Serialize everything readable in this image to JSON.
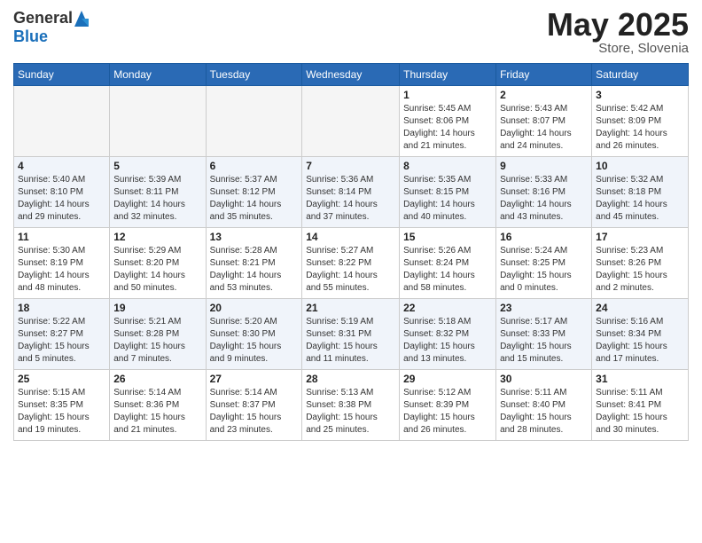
{
  "logo": {
    "general": "General",
    "blue": "Blue"
  },
  "header": {
    "month": "May 2025",
    "location": "Store, Slovenia"
  },
  "weekdays": [
    "Sunday",
    "Monday",
    "Tuesday",
    "Wednesday",
    "Thursday",
    "Friday",
    "Saturday"
  ],
  "weeks": [
    [
      {
        "day": "",
        "info": ""
      },
      {
        "day": "",
        "info": ""
      },
      {
        "day": "",
        "info": ""
      },
      {
        "day": "",
        "info": ""
      },
      {
        "day": "1",
        "info": "Sunrise: 5:45 AM\nSunset: 8:06 PM\nDaylight: 14 hours\nand 21 minutes."
      },
      {
        "day": "2",
        "info": "Sunrise: 5:43 AM\nSunset: 8:07 PM\nDaylight: 14 hours\nand 24 minutes."
      },
      {
        "day": "3",
        "info": "Sunrise: 5:42 AM\nSunset: 8:09 PM\nDaylight: 14 hours\nand 26 minutes."
      }
    ],
    [
      {
        "day": "4",
        "info": "Sunrise: 5:40 AM\nSunset: 8:10 PM\nDaylight: 14 hours\nand 29 minutes."
      },
      {
        "day": "5",
        "info": "Sunrise: 5:39 AM\nSunset: 8:11 PM\nDaylight: 14 hours\nand 32 minutes."
      },
      {
        "day": "6",
        "info": "Sunrise: 5:37 AM\nSunset: 8:12 PM\nDaylight: 14 hours\nand 35 minutes."
      },
      {
        "day": "7",
        "info": "Sunrise: 5:36 AM\nSunset: 8:14 PM\nDaylight: 14 hours\nand 37 minutes."
      },
      {
        "day": "8",
        "info": "Sunrise: 5:35 AM\nSunset: 8:15 PM\nDaylight: 14 hours\nand 40 minutes."
      },
      {
        "day": "9",
        "info": "Sunrise: 5:33 AM\nSunset: 8:16 PM\nDaylight: 14 hours\nand 43 minutes."
      },
      {
        "day": "10",
        "info": "Sunrise: 5:32 AM\nSunset: 8:18 PM\nDaylight: 14 hours\nand 45 minutes."
      }
    ],
    [
      {
        "day": "11",
        "info": "Sunrise: 5:30 AM\nSunset: 8:19 PM\nDaylight: 14 hours\nand 48 minutes."
      },
      {
        "day": "12",
        "info": "Sunrise: 5:29 AM\nSunset: 8:20 PM\nDaylight: 14 hours\nand 50 minutes."
      },
      {
        "day": "13",
        "info": "Sunrise: 5:28 AM\nSunset: 8:21 PM\nDaylight: 14 hours\nand 53 minutes."
      },
      {
        "day": "14",
        "info": "Sunrise: 5:27 AM\nSunset: 8:22 PM\nDaylight: 14 hours\nand 55 minutes."
      },
      {
        "day": "15",
        "info": "Sunrise: 5:26 AM\nSunset: 8:24 PM\nDaylight: 14 hours\nand 58 minutes."
      },
      {
        "day": "16",
        "info": "Sunrise: 5:24 AM\nSunset: 8:25 PM\nDaylight: 15 hours\nand 0 minutes."
      },
      {
        "day": "17",
        "info": "Sunrise: 5:23 AM\nSunset: 8:26 PM\nDaylight: 15 hours\nand 2 minutes."
      }
    ],
    [
      {
        "day": "18",
        "info": "Sunrise: 5:22 AM\nSunset: 8:27 PM\nDaylight: 15 hours\nand 5 minutes."
      },
      {
        "day": "19",
        "info": "Sunrise: 5:21 AM\nSunset: 8:28 PM\nDaylight: 15 hours\nand 7 minutes."
      },
      {
        "day": "20",
        "info": "Sunrise: 5:20 AM\nSunset: 8:30 PM\nDaylight: 15 hours\nand 9 minutes."
      },
      {
        "day": "21",
        "info": "Sunrise: 5:19 AM\nSunset: 8:31 PM\nDaylight: 15 hours\nand 11 minutes."
      },
      {
        "day": "22",
        "info": "Sunrise: 5:18 AM\nSunset: 8:32 PM\nDaylight: 15 hours\nand 13 minutes."
      },
      {
        "day": "23",
        "info": "Sunrise: 5:17 AM\nSunset: 8:33 PM\nDaylight: 15 hours\nand 15 minutes."
      },
      {
        "day": "24",
        "info": "Sunrise: 5:16 AM\nSunset: 8:34 PM\nDaylight: 15 hours\nand 17 minutes."
      }
    ],
    [
      {
        "day": "25",
        "info": "Sunrise: 5:15 AM\nSunset: 8:35 PM\nDaylight: 15 hours\nand 19 minutes."
      },
      {
        "day": "26",
        "info": "Sunrise: 5:14 AM\nSunset: 8:36 PM\nDaylight: 15 hours\nand 21 minutes."
      },
      {
        "day": "27",
        "info": "Sunrise: 5:14 AM\nSunset: 8:37 PM\nDaylight: 15 hours\nand 23 minutes."
      },
      {
        "day": "28",
        "info": "Sunrise: 5:13 AM\nSunset: 8:38 PM\nDaylight: 15 hours\nand 25 minutes."
      },
      {
        "day": "29",
        "info": "Sunrise: 5:12 AM\nSunset: 8:39 PM\nDaylight: 15 hours\nand 26 minutes."
      },
      {
        "day": "30",
        "info": "Sunrise: 5:11 AM\nSunset: 8:40 PM\nDaylight: 15 hours\nand 28 minutes."
      },
      {
        "day": "31",
        "info": "Sunrise: 5:11 AM\nSunset: 8:41 PM\nDaylight: 15 hours\nand 30 minutes."
      }
    ]
  ]
}
